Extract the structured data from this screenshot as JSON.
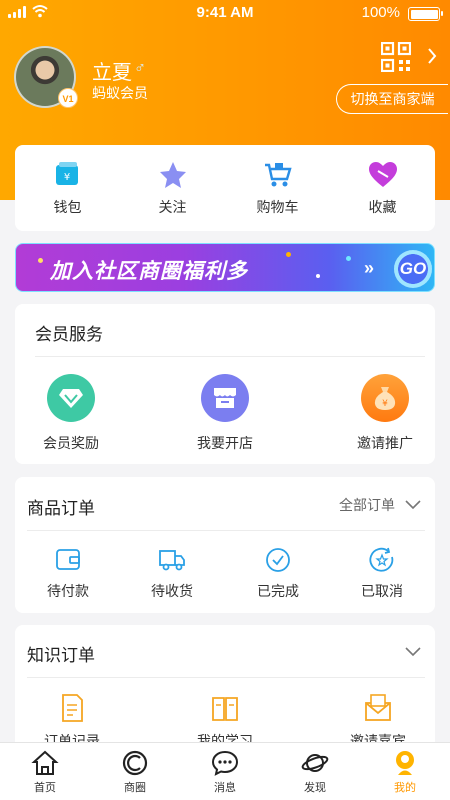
{
  "status_bar": {
    "time": "9:41 AM",
    "battery": "100%"
  },
  "profile": {
    "name": "立夏",
    "gender_symbol": "♂",
    "member_type": "蚂蚁会员",
    "level": "V1",
    "switch_label": "切换至商家端"
  },
  "quick_actions": [
    {
      "label": "钱包",
      "icon": "wallet-icon"
    },
    {
      "label": "关注",
      "icon": "star-icon"
    },
    {
      "label": "购物车",
      "icon": "cart-icon"
    },
    {
      "label": "收藏",
      "icon": "heart-icon"
    }
  ],
  "banner": {
    "text": "加入社区商圈福利多",
    "arrows": "»",
    "go": "GO"
  },
  "member_services": {
    "title": "会员服务",
    "items": [
      {
        "label": "会员奖励",
        "icon": "diamond-icon",
        "color": "#3ec9a4"
      },
      {
        "label": "我要开店",
        "icon": "store-icon",
        "color": "#7b7ef0"
      },
      {
        "label": "邀请推广",
        "icon": "money-bag-icon",
        "color": "#ff8a20"
      }
    ]
  },
  "product_orders": {
    "title": "商品订单",
    "all_label": "全部订单",
    "items": [
      {
        "label": "待付款",
        "icon": "wallet-outline-icon"
      },
      {
        "label": "待收货",
        "icon": "truck-icon"
      },
      {
        "label": "已完成",
        "icon": "check-circle-icon"
      },
      {
        "label": "已取消",
        "icon": "cancel-circle-icon"
      }
    ]
  },
  "knowledge_orders": {
    "title": "知识订单",
    "items": [
      {
        "label": "订单记录",
        "icon": "document-icon"
      },
      {
        "label": "我的学习",
        "icon": "book-icon"
      },
      {
        "label": "邀请嘉宾",
        "icon": "envelope-icon"
      }
    ]
  },
  "tabs": [
    {
      "label": "首页",
      "icon": "home-icon"
    },
    {
      "label": "商圈",
      "icon": "circle-icon"
    },
    {
      "label": "消息",
      "icon": "message-icon"
    },
    {
      "label": "发现",
      "icon": "planet-icon"
    },
    {
      "label": "我的",
      "icon": "profile-icon"
    }
  ],
  "colors": {
    "accent": "#ff9800",
    "icon_blue": "#2aa0e6"
  }
}
